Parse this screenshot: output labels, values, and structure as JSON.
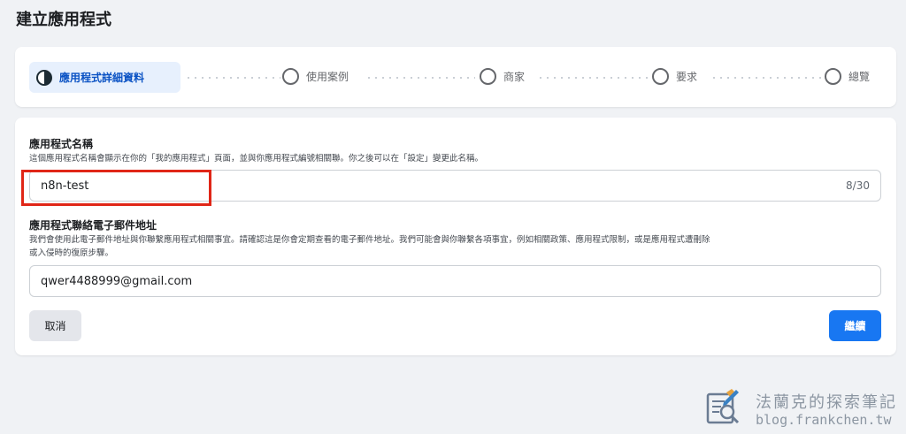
{
  "page": {
    "title": "建立應用程式"
  },
  "stepper": {
    "steps": [
      {
        "label": "應用程式詳細資料",
        "state": "active"
      },
      {
        "label": "使用案例",
        "state": "pending"
      },
      {
        "label": "商家",
        "state": "pending"
      },
      {
        "label": "要求",
        "state": "pending"
      },
      {
        "label": "總覽",
        "state": "pending"
      }
    ]
  },
  "form": {
    "app_name": {
      "title": "應用程式名稱",
      "description": "這個應用程式名稱會顯示在你的「我的應用程式」頁面，並與你應用程式編號相關聯。你之後可以在「設定」變更此名稱。",
      "value": "n8n-test",
      "char_count": "8/30"
    },
    "contact_email": {
      "title": "應用程式聯絡電子郵件地址",
      "description_line1": "我們會使用此電子郵件地址與你聯繫應用程式相關事宜。請確認這是你會定期查看的電子郵件地址。我們可能會與你聯繫各項事宜，例如相關政策、應用程式限制，或是應用程式遭刪除",
      "description_line2": "或入侵時的復原步驟。",
      "value": "qwer4488999@gmail.com"
    },
    "buttons": {
      "cancel": "取消",
      "continue": "繼續"
    }
  },
  "watermark": {
    "name": "法蘭克的探索筆記",
    "url": "blog.frankchen.tw"
  },
  "colors": {
    "accent": "#1877f2",
    "highlight": "#e02617",
    "active_step_bg": "#e7f0fd"
  }
}
